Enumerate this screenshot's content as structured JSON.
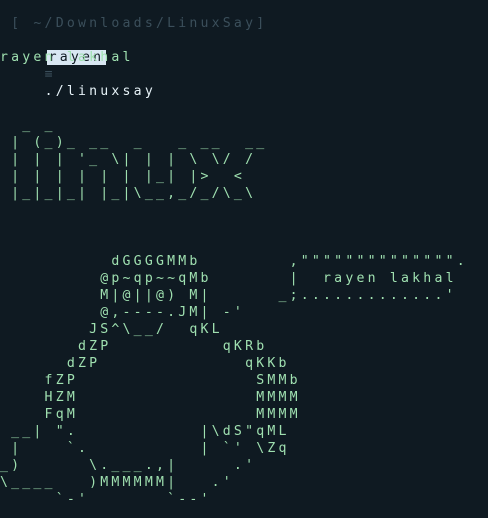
{
  "window": {
    "cwd_label": " [ ~/Downloads/LinuxSay]"
  },
  "prompt": {
    "user": "rayen",
    "separator": "≡",
    "command": "./linuxsay"
  },
  "output": {
    "name": "rayen lakhal",
    "banner": [
      "  _ _",
      " | (_)_ __  _   _ __  __",
      " | | | '_ \\| | | \\ \\/ /",
      " | | | | | | |_| |>  <",
      " |_|_|_| |_|\\__,_/_/\\_\\"
    ],
    "art": [
      "          dGGGGMMb        ,\"\"\"\"\"\"\"\"\"\"\"\"\"\".",
      "         @p~qp~~qMb       |  rayen lakhal",
      "         M|@||@) M|      _;.............'",
      "         @,----.JM| -'",
      "        JS^\\__/  qKL",
      "       dZP          qKRb",
      "      dZP             qKKb",
      "    fZP                SMMb",
      "    HZM                MMMM",
      "    FqM                MMMM",
      " __| \".           |\\dS\"qML",
      " |    `.          | `' \\Zq",
      "_)      \\.___.,|     .'",
      "\\____   )MMMMMM|   .'",
      "     `-'       `--'"
    ]
  }
}
